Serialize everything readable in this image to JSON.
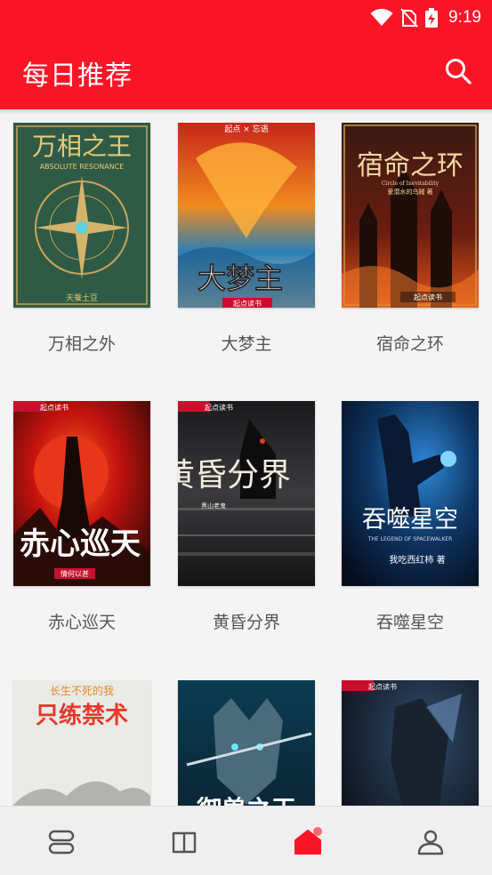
{
  "status": {
    "time": "9:19"
  },
  "header": {
    "title": "每日推荐"
  },
  "books": [
    {
      "title": "万相之外",
      "cover_text": "万相之王",
      "cover_subtext": "ABSOLUTE RESONANCE",
      "cover_author": "天蚕土豆"
    },
    {
      "title": "大梦主",
      "cover_text": "大梦主",
      "cover_top": "起点 × 忘语",
      "cover_badge": "起点读书"
    },
    {
      "title": "宿命之环",
      "cover_text": "宿命之环",
      "cover_subtext": "Circle of Inevitability",
      "cover_author": "爱潜水的乌贼 著",
      "cover_badge": "起点读书"
    },
    {
      "title": "赤心巡天",
      "cover_text": "赤心巡天",
      "cover_author": "情何以甚",
      "cover_badge": "起点读书"
    },
    {
      "title": "黄昏分界",
      "cover_text": "黄昏分界",
      "cover_author": "黑山老鬼",
      "cover_badge": "起点读书"
    },
    {
      "title": "吞噬星空",
      "cover_text": "吞噬星空",
      "cover_subtext": "THE LEGEND OF SPACEWALKER",
      "cover_author": "我吃西红柿 著"
    },
    {
      "title": "",
      "cover_text": "只练禁术",
      "cover_top": "长生不死的我"
    },
    {
      "title": "",
      "cover_text": "御兽之王"
    },
    {
      "title": "",
      "cover_badge": "起点读书"
    }
  ],
  "nav": {
    "items": [
      "bookshelf",
      "library",
      "recommend",
      "profile"
    ],
    "active": "recommend"
  },
  "colors": {
    "accent": "#fb1527",
    "nav_bg": "#efefef",
    "page_bg": "#f4f4f4"
  }
}
